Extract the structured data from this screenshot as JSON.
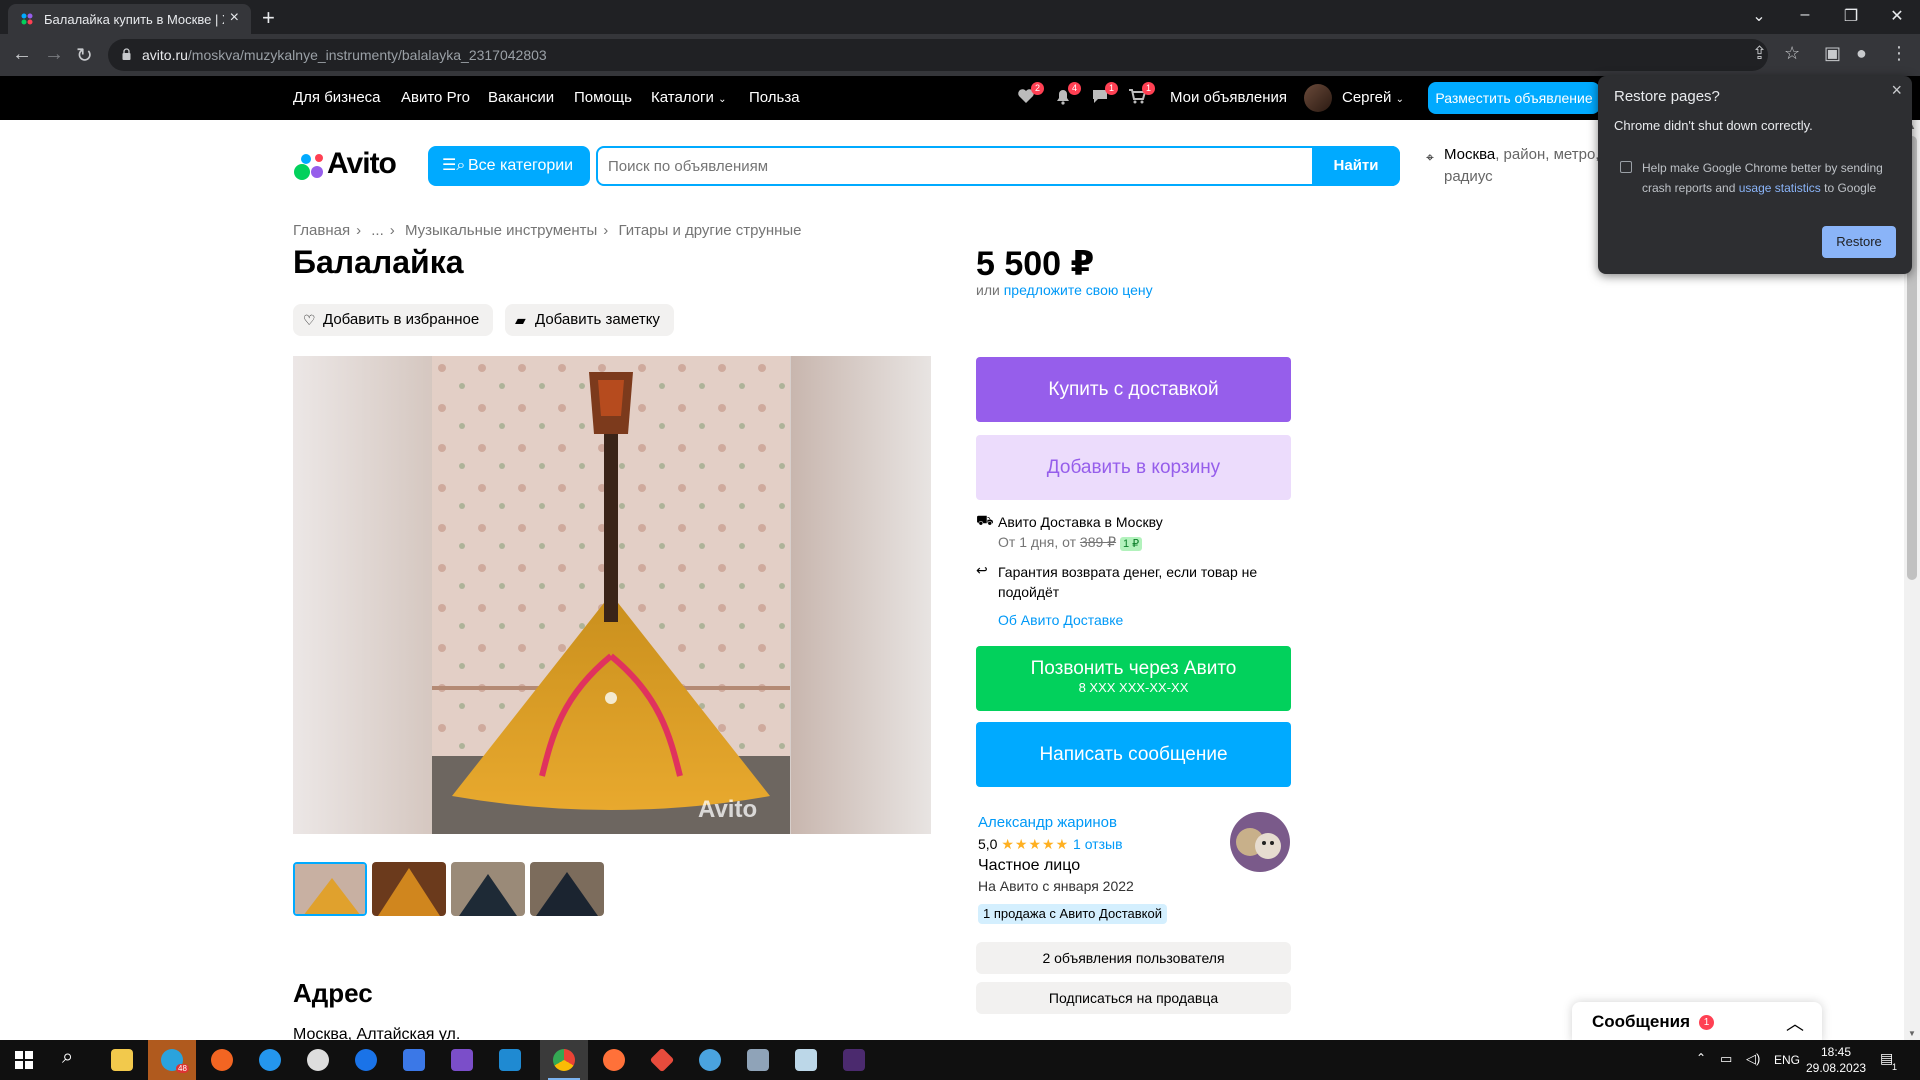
{
  "browser": {
    "tab_title": "Балалайка купить в Москве | Хо",
    "new_tab": "+",
    "url_host": "avito.ru",
    "url_path": "/moskva/muzykalnye_instrumenty/balalayka_2317042803"
  },
  "topnav": {
    "links": [
      "Для бизнеса",
      "Авито Pro",
      "Вакансии",
      "Помощь",
      "Каталоги",
      "Польза"
    ],
    "badges": {
      "favorites": "2",
      "notifications": "4",
      "messages": "1",
      "cart": "1"
    },
    "my_ads": "Мои объявления",
    "user_name": "Сергей",
    "post_ad": "Разместить объявление"
  },
  "header": {
    "logo": "Avito",
    "all_categories": "Все категории",
    "search_placeholder": "Поиск по объявлениям",
    "search_button": "Найти",
    "location_main": "Москва",
    "location_rest": ", район, метро, радиус"
  },
  "breadcrumb": [
    "Главная",
    "...",
    "Музыкальные инструменты",
    "Гитары и другие струнные"
  ],
  "item": {
    "title": "Балалайка",
    "add_favorite": "Добавить в избранное",
    "add_note": "Добавить заметку",
    "watermark": "Avito",
    "price": "5 500 ₽",
    "price_or": "или",
    "price_offer": "предложите свою цену"
  },
  "actions": {
    "buy": "Купить с доставкой",
    "cart": "Добавить в корзину",
    "call": "Позвонить через Авито",
    "phone": "8 XXX XXX-XX-XX",
    "message": "Написать сообщение"
  },
  "delivery": {
    "title": "Авито Доставка в Москву",
    "from": "От 1 дня, от",
    "old_price": "389 ₽",
    "new_price": "1 ₽",
    "guarantee": "Гарантия возврата денег, если товар не подойдёт",
    "about": "Об Авито Доставке"
  },
  "seller": {
    "name": "Александр жаринов",
    "rating": "5,0",
    "stars": "★★★★★",
    "reviews": "1 отзыв",
    "type": "Частное лицо",
    "since": "На Авито с января 2022",
    "badge": "1 продажа с Авито Доставкой",
    "ads_count": "2 объявления пользователя",
    "subscribe": "Подписаться на продавца"
  },
  "address": {
    "heading": "Адрес",
    "text": "Москва, Алтайская ул."
  },
  "messages_widget": {
    "label": "Сообщения",
    "count": "1"
  },
  "restore_popup": {
    "title": "Restore pages?",
    "body": "Chrome didn't shut down correctly.",
    "checkbox_text_1": "Help make Google Chrome better by sending crash reports and",
    "checkbox_link": "usage statistics",
    "checkbox_text_2": "to Google",
    "button": "Restore"
  },
  "taskbar": {
    "telegram_badge": "48",
    "lang": "ENG",
    "time": "18:45",
    "date": "29.08.2023",
    "notif_count": "1"
  },
  "colors": {
    "avito_blue": "#00aaff",
    "buy_purple": "#965eeb",
    "call_green": "#02d15c",
    "badge_red": "#ff4053"
  }
}
